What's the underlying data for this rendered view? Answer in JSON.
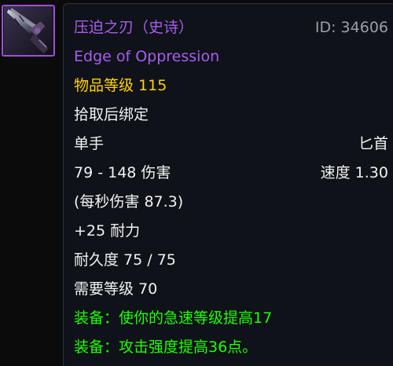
{
  "item": {
    "name_cn": "压迫之刃（史诗）",
    "id_label": "ID: 34606",
    "name_en": "Edge of Oppression",
    "item_level_label": "物品等级",
    "item_level": "115",
    "binding": "拾取后绑定",
    "slot": "单手",
    "weapon_type": "匕首",
    "damage": "79 - 148 伤害",
    "speed": "速度 1.30",
    "dps": "(每秒伤害 87.3)",
    "stat": "+25 耐力",
    "durability": "耐久度 75 / 75",
    "required_level": "需要等级 70",
    "equip_effects": [
      "装备：使你的急速等级提高17",
      "装备：攻击强度提高36点。"
    ]
  },
  "icon": {
    "name": "dagger-icon",
    "border_color": "#9b4fd6"
  },
  "colors": {
    "epic": "#a65ef0",
    "item_level": "#ffd100",
    "equip": "#1eff00",
    "text": "#f2f2f2",
    "id": "#9a9fa8"
  }
}
